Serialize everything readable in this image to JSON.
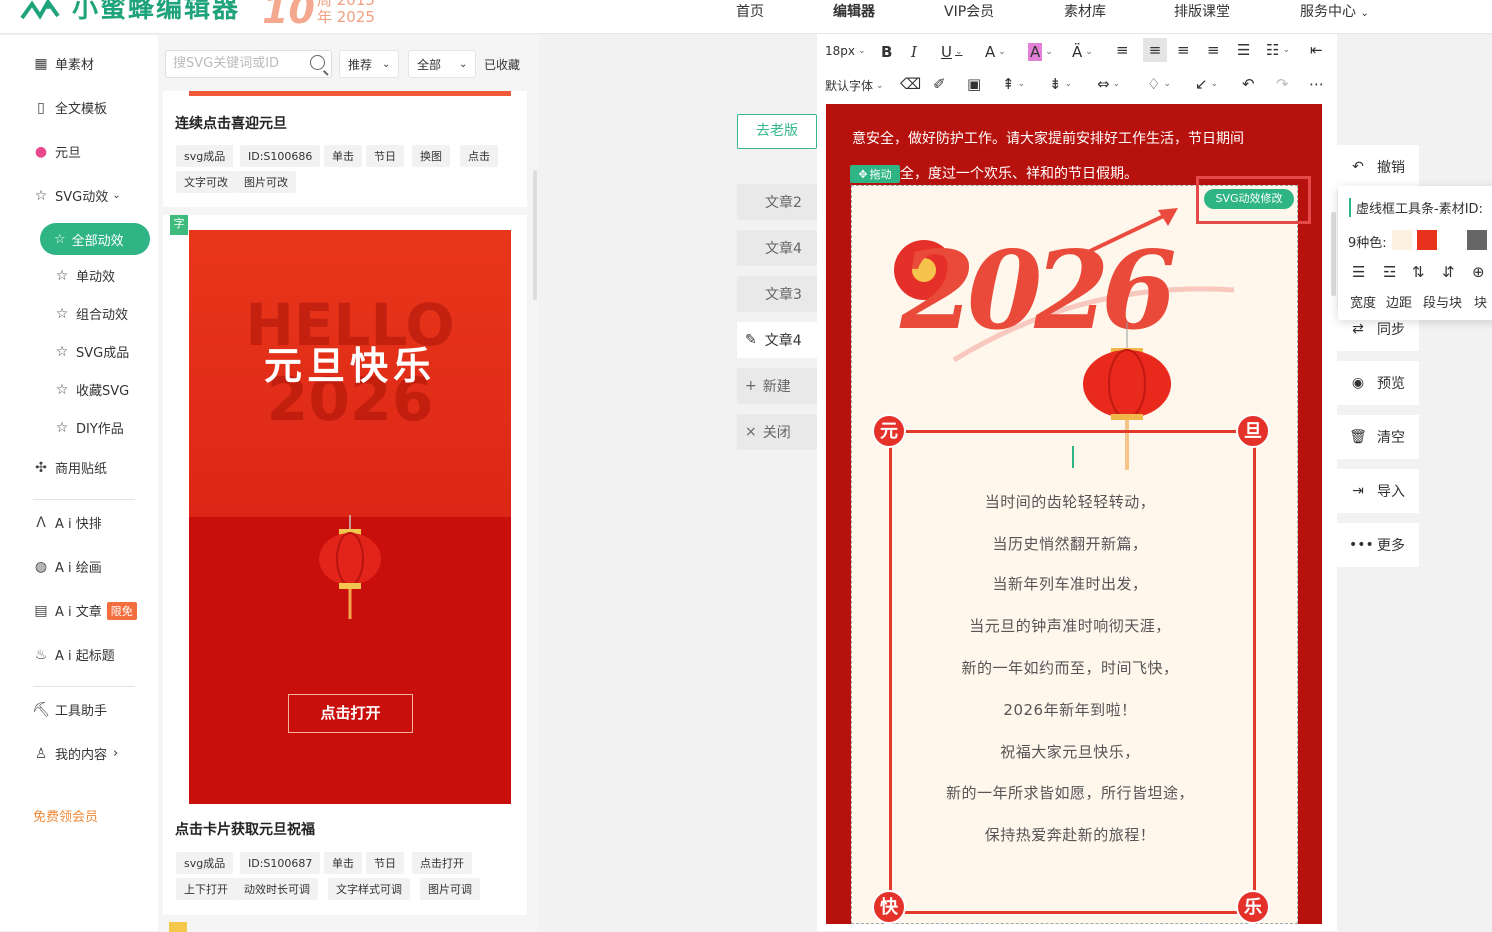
{
  "brand": {
    "name": "小蜜蜂编辑器",
    "anniv_number": "10",
    "anniv_years": "年 2025",
    "anniv_years_top": "周 2015"
  },
  "nav": [
    "首页",
    "编辑器",
    "VIP会员",
    "素材库",
    "排版课堂",
    "服务中心"
  ],
  "sidebar": {
    "items": [
      {
        "label": "单素材",
        "icon": "grid-icon"
      },
      {
        "label": "全文模板",
        "icon": "template-icon"
      },
      {
        "label": "元旦",
        "icon": "balloon-icon"
      },
      {
        "label": "SVG动效",
        "icon": "star-icon"
      },
      {
        "label": "全部动效",
        "icon": "star-icon"
      },
      {
        "label": "单动效",
        "icon": "star-icon"
      },
      {
        "label": "组合动效",
        "icon": "star-icon"
      },
      {
        "label": "SVG成品",
        "icon": "star-icon"
      },
      {
        "label": "收藏SVG",
        "icon": "star-icon"
      },
      {
        "label": "DIY作品",
        "icon": "star-icon"
      },
      {
        "label": "商用贴纸",
        "icon": "puzzle-icon"
      },
      {
        "label": "A i 快排",
        "icon": "ai-icon"
      },
      {
        "label": "A i 绘画",
        "icon": "palette-icon"
      },
      {
        "label": "A i 文章",
        "icon": "doc-icon",
        "badge": "限免"
      },
      {
        "label": "A i 起标题",
        "icon": "fire-icon"
      },
      {
        "label": "工具助手",
        "icon": "tool-icon"
      },
      {
        "label": "我的内容",
        "icon": "user-icon"
      }
    ],
    "free_member": "免费领会员"
  },
  "panel": {
    "search_placeholder": "搜SVG关键词或ID",
    "filter1": "推荐",
    "filter2": "全部",
    "favorites": "已收藏",
    "card1": {
      "title": "连续点击喜迎元旦",
      "tags": [
        "svg成品",
        "ID:S100686",
        "单击",
        "节日",
        "换图",
        "点击",
        "文字可改",
        "图片可改"
      ]
    },
    "card2": {
      "corner_tag": "字",
      "preview_hello": "HELLO",
      "preview_year": "2026",
      "preview_title": "元旦快乐",
      "preview_button": "点击打开",
      "title": "点击卡片获取元旦祝福",
      "tags": [
        "svg成品",
        "ID:S100687",
        "单击",
        "节日",
        "点击打开",
        "上下打开",
        "动效时长可调",
        "文字样式可调",
        "图片可调"
      ]
    }
  },
  "middle": {
    "old_version": "去老版",
    "articles": [
      "文章2",
      "文章4",
      "文章3",
      "文章4"
    ],
    "new": "新建",
    "close": "关闭"
  },
  "toolbar": {
    "font_size": "18px",
    "font_family": "默认字体"
  },
  "canvas": {
    "line1": "意安全，做好防护工作。请大家提前安排好工作生活，节日期间",
    "line2": "全，度过一个欢乐、祥和的节日假期。",
    "drag": "拖动",
    "svg_badge": "SVG动效修改",
    "year_art": "2026",
    "corners": [
      "元",
      "旦",
      "快",
      "乐"
    ],
    "poem": [
      "当时间的齿轮轻轻转动，",
      "当历史悄然翻开新篇，",
      "当新年列车准时出发，",
      "当元旦的钟声准时响彻天涯，",
      "新的一年如约而至，时间飞快，",
      "2026年新年到啦！",
      "祝福大家元旦快乐，",
      "新的一年所求皆如愿，所行皆坦途，",
      "保持热爱奔赴新的旅程！"
    ]
  },
  "right_tools": [
    "撤销",
    "同步",
    "预览",
    "清空",
    "导入",
    "更多"
  ],
  "popup": {
    "title": "虚线框工具条-素材ID:",
    "colors_label": "9种色:",
    "colors": [
      "#fdf1e2",
      "#e8321e",
      "#ffffff",
      "#666666"
    ],
    "labels": [
      "宽度",
      "边距",
      "段与块",
      "块"
    ]
  }
}
